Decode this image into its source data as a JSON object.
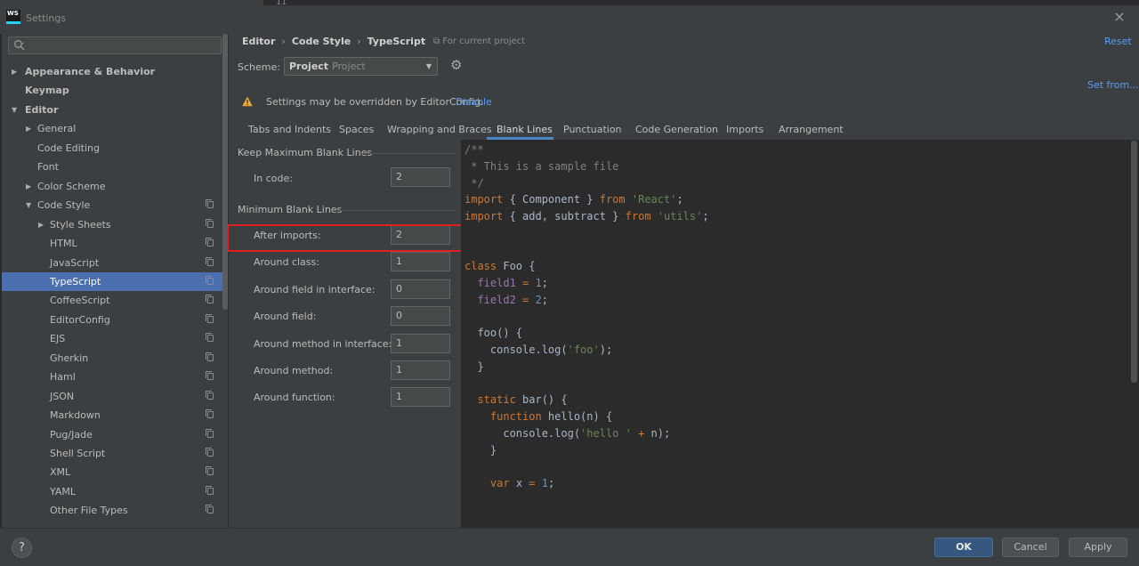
{
  "window": {
    "title": "Settings",
    "app_icon_text": "WS",
    "bg_line_number": "11"
  },
  "sidebar": {
    "search_placeholder": "",
    "items": [
      {
        "label": "Appearance & Behavior",
        "level": 0,
        "bold": true,
        "arrow": "right"
      },
      {
        "label": "Keymap",
        "level": 0,
        "bold": true,
        "arrow": ""
      },
      {
        "label": "Editor",
        "level": 0,
        "bold": true,
        "arrow": "down"
      },
      {
        "label": "General",
        "level": 1,
        "arrow": "right"
      },
      {
        "label": "Code Editing",
        "level": 1,
        "arrow": ""
      },
      {
        "label": "Font",
        "level": 1,
        "arrow": ""
      },
      {
        "label": "Color Scheme",
        "level": 1,
        "arrow": "right"
      },
      {
        "label": "Code Style",
        "level": 1,
        "arrow": "down",
        "copy": true
      },
      {
        "label": "Style Sheets",
        "level": 2,
        "arrow": "right",
        "copy": true
      },
      {
        "label": "HTML",
        "level": 2,
        "arrow": "",
        "copy": true
      },
      {
        "label": "JavaScript",
        "level": 2,
        "arrow": "",
        "copy": true
      },
      {
        "label": "TypeScript",
        "level": 2,
        "arrow": "",
        "copy": true,
        "selected": true
      },
      {
        "label": "CoffeeScript",
        "level": 2,
        "arrow": "",
        "copy": true
      },
      {
        "label": "EditorConfig",
        "level": 2,
        "arrow": "",
        "copy": true
      },
      {
        "label": "EJS",
        "level": 2,
        "arrow": "",
        "copy": true
      },
      {
        "label": "Gherkin",
        "level": 2,
        "arrow": "",
        "copy": true
      },
      {
        "label": "Haml",
        "level": 2,
        "arrow": "",
        "copy": true
      },
      {
        "label": "JSON",
        "level": 2,
        "arrow": "",
        "copy": true
      },
      {
        "label": "Markdown",
        "level": 2,
        "arrow": "",
        "copy": true
      },
      {
        "label": "Pug/Jade",
        "level": 2,
        "arrow": "",
        "copy": true
      },
      {
        "label": "Shell Script",
        "level": 2,
        "arrow": "",
        "copy": true
      },
      {
        "label": "XML",
        "level": 2,
        "arrow": "",
        "copy": true
      },
      {
        "label": "YAML",
        "level": 2,
        "arrow": "",
        "copy": true
      },
      {
        "label": "Other File Types",
        "level": 2,
        "arrow": "",
        "copy": true
      }
    ]
  },
  "header": {
    "breadcrumb": [
      "Editor",
      "Code Style",
      "TypeScript"
    ],
    "for_project": "For current project",
    "reset": "Reset",
    "scheme_label": "Scheme:",
    "scheme_value": "Project",
    "scheme_sub": "Project",
    "set_from": "Set from...",
    "warning_text": "Settings may be overridden by EditorConfig.",
    "warning_link": "Disable"
  },
  "tabs": [
    {
      "label": "Tabs and Indents"
    },
    {
      "label": "Spaces"
    },
    {
      "label": "Wrapping and Braces"
    },
    {
      "label": "Blank Lines",
      "active": true
    },
    {
      "label": "Punctuation"
    },
    {
      "label": "Code Generation"
    },
    {
      "label": "Imports"
    },
    {
      "label": "Arrangement"
    }
  ],
  "blank_lines": {
    "keep_title": "Keep Maximum Blank Lines",
    "min_title": "Minimum Blank Lines",
    "keep_rows": [
      {
        "label": "In code:",
        "value": "2"
      }
    ],
    "min_rows": [
      {
        "label": "After imports:",
        "value": "2"
      },
      {
        "label": "Around class:",
        "value": "1"
      },
      {
        "label": "Around field in interface:",
        "value": "0"
      },
      {
        "label": "Around field:",
        "value": "0"
      },
      {
        "label": "Around method in interface:",
        "value": "1"
      },
      {
        "label": "Around method:",
        "value": "1"
      },
      {
        "label": "Around function:",
        "value": "1"
      }
    ]
  },
  "code_preview": {
    "lines": [
      "/**",
      " * This is a sample file",
      " */",
      "import { Component } from 'React';",
      "import { add, subtract } from 'utils';",
      "",
      "",
      "class Foo {",
      "  field1 = 1;",
      "  field2 = 2;",
      "",
      "  foo() {",
      "    console.log('foo');",
      "  }",
      "",
      "  static bar() {",
      "    function hello(n) {",
      "      console.log('hello ' + n);",
      "    }",
      "",
      "    var x = 1;"
    ]
  },
  "footer": {
    "help": "?",
    "ok": "OK",
    "cancel": "Cancel",
    "apply": "Apply"
  },
  "colors": {
    "accent": "#4b6eaf",
    "link": "#589df6",
    "highlight_box": "#e02020",
    "primary_button": "#365880"
  }
}
